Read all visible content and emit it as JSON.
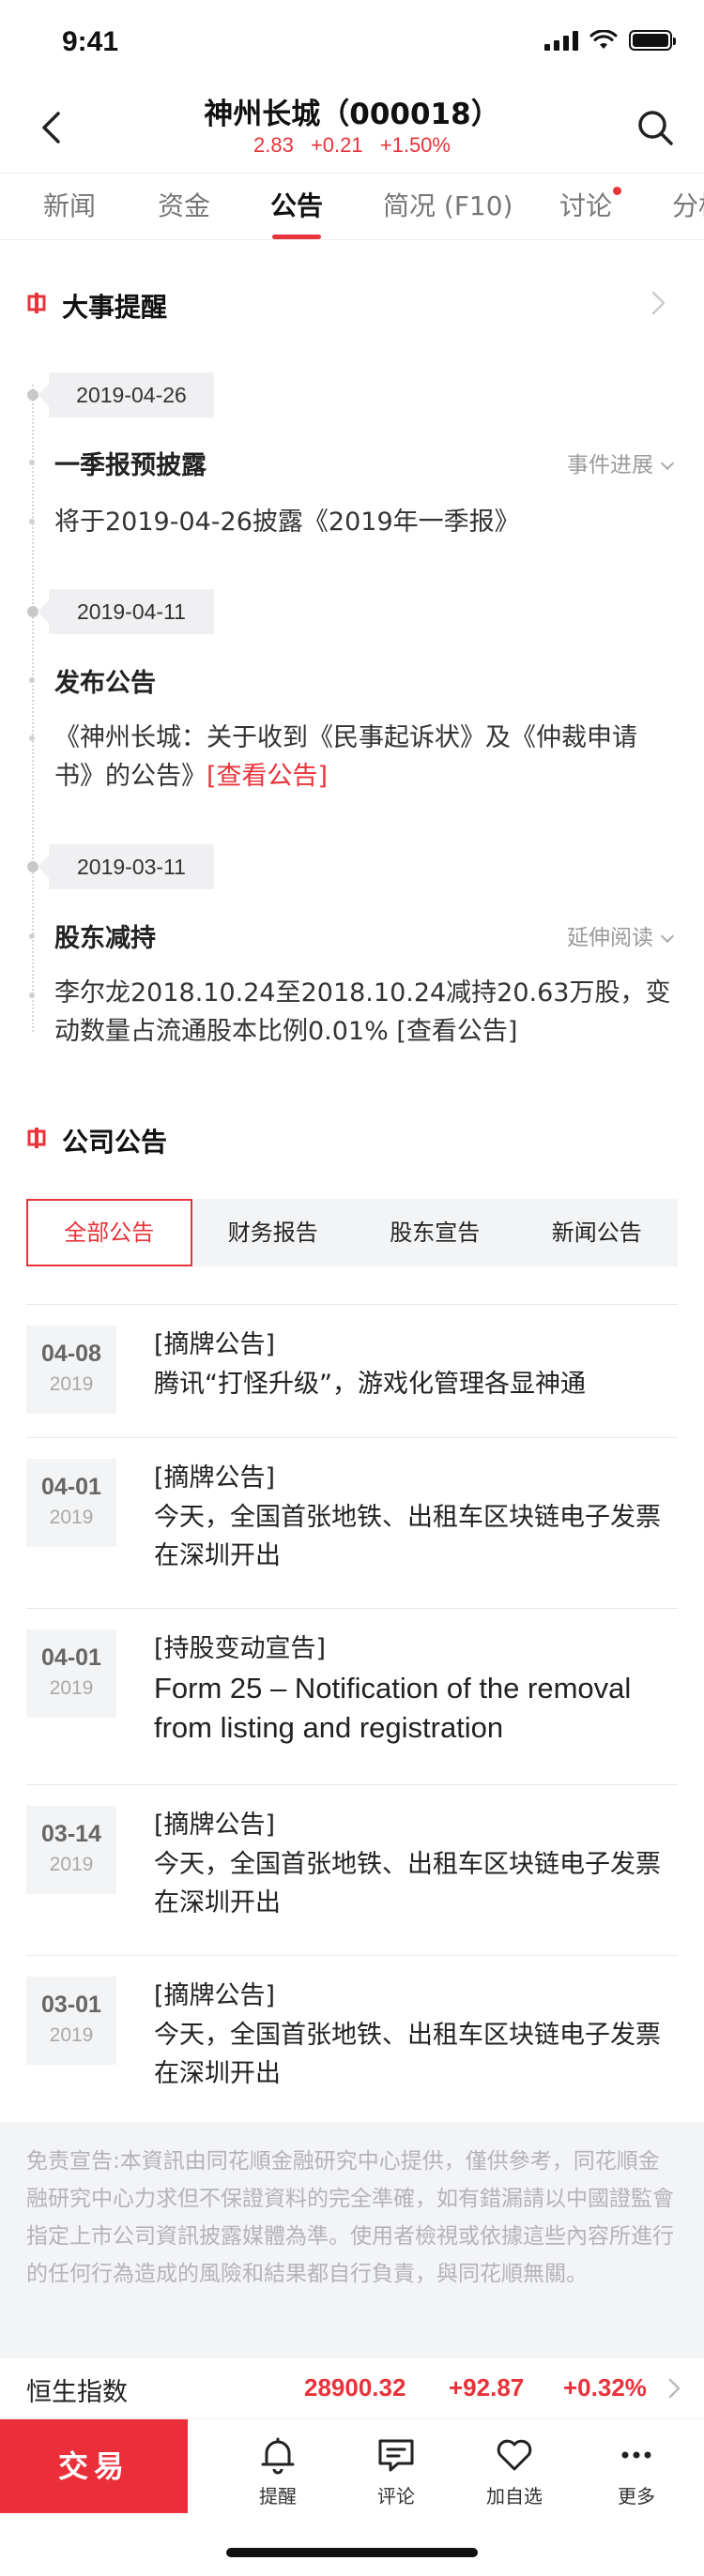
{
  "status": {
    "time": "9:41"
  },
  "header": {
    "title": "神州长城（000018）",
    "price": "2.83",
    "change": "+0.21",
    "change_pct": "+1.50%"
  },
  "tabs": [
    {
      "label": "新闻",
      "active": false
    },
    {
      "label": "资金",
      "active": false
    },
    {
      "label": "公告",
      "active": true
    },
    {
      "label": "简况 (F10)",
      "active": false
    },
    {
      "label": "讨论",
      "active": false,
      "dot": true
    },
    {
      "label": "分析",
      "active": false
    }
  ],
  "events_section": {
    "title": "大事提醒",
    "events": [
      {
        "date": "2019-04-26",
        "title": "一季报预披露",
        "tag": "事件进展",
        "desc": "将于2019-04-26披露《2019年一季报》"
      },
      {
        "date": "2019-04-11",
        "title": "发布公告",
        "desc": "《神州长城：关于收到《民事起诉状》及《仲裁申请书》的公告》",
        "link": "[查看公告]"
      },
      {
        "date": "2019-03-11",
        "title": "股东减持",
        "tag": "延伸阅读",
        "desc": "李尔龙2018.10.24至2018.10.24减持20.63万股，变动数量占流通股本比例0.01%",
        "link": "[查看公告]"
      }
    ]
  },
  "notices_section": {
    "title": "公司公告",
    "filters": [
      {
        "label": "全部公告",
        "active": true
      },
      {
        "label": "财务报告",
        "active": false
      },
      {
        "label": "股东宣告",
        "active": false
      },
      {
        "label": "新闻公告",
        "active": false
      }
    ],
    "items": [
      {
        "md": "04-08",
        "year": "2019",
        "category": "[摘牌公告]",
        "text": "腾讯“打怪升级”，游戏化管理各显神通"
      },
      {
        "md": "04-01",
        "year": "2019",
        "category": "[摘牌公告]",
        "text": "今天，全国首张地铁、出租车区块链电子发票在深圳开出"
      },
      {
        "md": "04-01",
        "year": "2019",
        "category": "[持股变动宣告]",
        "text": "Form 25 – Notification of the removal from listing and registration",
        "en": true
      },
      {
        "md": "03-14",
        "year": "2019",
        "category": "[摘牌公告]",
        "text": "今天，全国首张地铁、出租车区块链电子发票在深圳开出"
      },
      {
        "md": "03-01",
        "year": "2019",
        "category": "[摘牌公告]",
        "text": "今天，全国首张地铁、出租车区块链电子发票在深圳开出"
      }
    ]
  },
  "disclaimer": "免责宣告:本資訊由同花順金融研究中心提供，僅供參考，同花順金融研究中心力求但不保證資料的完全準確，如有錯漏請以中國證監會指定上市公司資訊披露媒體為準。使用者檢視或依據這些內容所進行的任何行為造成的風險和結果都自行負責，與同花順無關。",
  "index_bar": {
    "name": "恒生指数",
    "value": "28900.32",
    "change": "+92.87",
    "change_pct": "+0.32%"
  },
  "bottom_bar": {
    "trade": "交易",
    "items": [
      {
        "label": "提醒",
        "icon": "bell-icon"
      },
      {
        "label": "评论",
        "icon": "comment-icon"
      },
      {
        "label": "加自选",
        "icon": "heart-icon"
      },
      {
        "label": "更多",
        "icon": "more-icon"
      }
    ]
  },
  "colors": {
    "accent": "#e8333a",
    "trade": "#ea2f3b",
    "muted_bg": "#f3f4f6"
  }
}
